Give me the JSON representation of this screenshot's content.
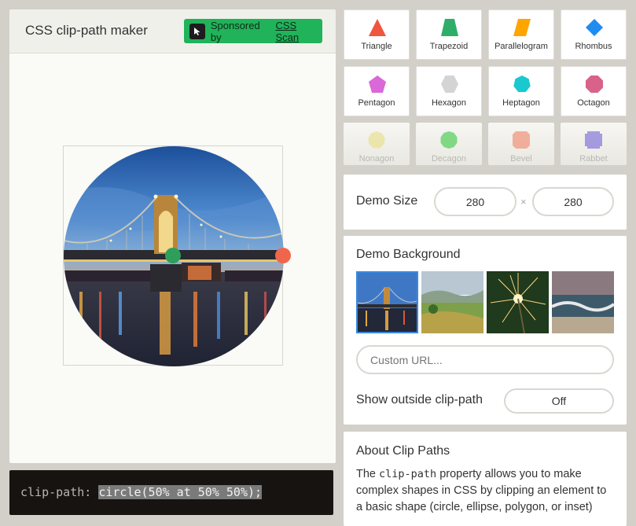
{
  "app": {
    "title": "CSS clip-path maker",
    "sponsor_prefix": "Sponsored by",
    "sponsor_link": "CSS Scan"
  },
  "code": {
    "property": "clip-path:",
    "value": "circle(50% at 50% 50%);"
  },
  "shapes": [
    {
      "label": "Triangle",
      "icon": "triangle-icon",
      "color": "#f0553f"
    },
    {
      "label": "Trapezoid",
      "icon": "trapezoid-icon",
      "color": "#2fae6a"
    },
    {
      "label": "Parallelogram",
      "icon": "parallelogram-icon",
      "color": "#ffa500"
    },
    {
      "label": "Rhombus",
      "icon": "rhombus-icon",
      "color": "#1e8cf0"
    },
    {
      "label": "Pentagon",
      "icon": "pentagon-icon",
      "color": "#d969d9"
    },
    {
      "label": "Hexagon",
      "icon": "hexagon-icon",
      "color": "#d4d4d4"
    },
    {
      "label": "Heptagon",
      "icon": "heptagon-icon",
      "color": "#1ac8cf"
    },
    {
      "label": "Octagon",
      "icon": "octagon-icon",
      "color": "#d9628a"
    },
    {
      "label": "Nonagon",
      "icon": "nonagon-icon",
      "color": "#e9e08c"
    },
    {
      "label": "Decagon",
      "icon": "decagon-icon",
      "color": "#45cc4f"
    },
    {
      "label": "Bevel",
      "icon": "bevel-icon",
      "color": "#f18c6f"
    },
    {
      "label": "Rabbet",
      "icon": "rabbet-icon",
      "color": "#7b6fd9"
    }
  ],
  "demo_size": {
    "label": "Demo Size",
    "width": "280",
    "times": "×",
    "height": "280"
  },
  "demo_background": {
    "label": "Demo Background",
    "thumbnails": [
      "bridge-night-photo",
      "hills-landscape-photo",
      "sparkler-photo",
      "ocean-waves-photo"
    ],
    "custom_url_placeholder": "Custom URL..."
  },
  "show_outside": {
    "label": "Show outside clip-path",
    "value": "Off"
  },
  "about": {
    "title": "About Clip Paths",
    "text_before": "The",
    "code": "clip-path",
    "text_after": "property allows you to make complex shapes in CSS by clipping an element to a basic shape (circle, ellipse, polygon, or inset)"
  }
}
